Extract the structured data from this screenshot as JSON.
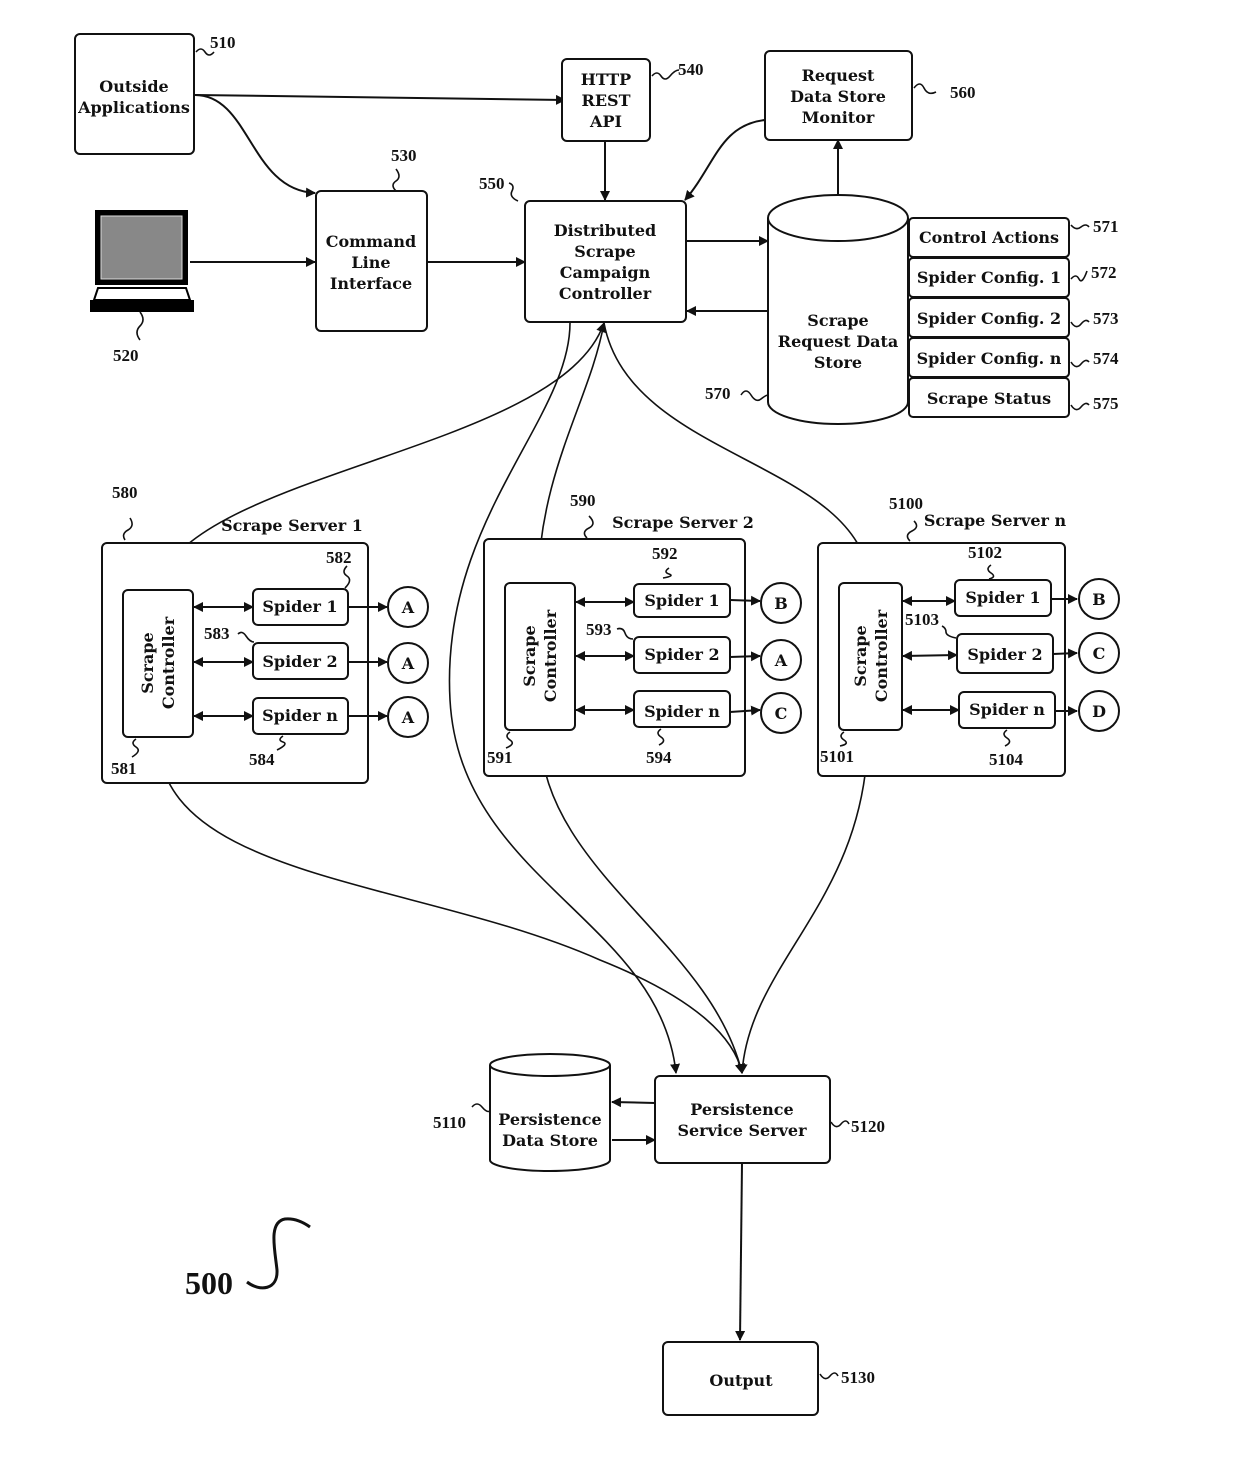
{
  "figure_number": "500",
  "nodes": {
    "outside_apps": {
      "ref": "510",
      "lines": [
        "Outside",
        "Applications"
      ]
    },
    "terminal": {
      "ref": "520",
      "icon": "laptop-icon"
    },
    "cli": {
      "ref": "530",
      "lines": [
        "Command",
        "Line",
        "Interface"
      ]
    },
    "http_api": {
      "ref": "540",
      "lines": [
        "HTTP",
        "REST",
        "API"
      ]
    },
    "controller": {
      "ref": "550",
      "lines": [
        "Distributed",
        "Scrape",
        "Campaign",
        "Controller"
      ]
    },
    "monitor": {
      "ref": "560",
      "lines": [
        "Request",
        "Data Store",
        "Monitor"
      ]
    },
    "request_store": {
      "ref": "570",
      "lines": [
        "Scrape",
        "Request Data",
        "Store"
      ]
    },
    "store_items": [
      {
        "ref": "571",
        "label": "Control Actions"
      },
      {
        "ref": "572",
        "label": "Spider Config. 1"
      },
      {
        "ref": "573",
        "label": "Spider Config. 2"
      },
      {
        "ref": "574",
        "label": "Spider Config. n"
      },
      {
        "ref": "575",
        "label": "Scrape Status"
      }
    ],
    "servers": [
      {
        "ref": "580",
        "title": "Scrape Server 1",
        "controller_ref": "581",
        "controller_lines": [
          "Scrape",
          "Controller"
        ],
        "spiders": [
          {
            "ref": "582",
            "label": "Spider 1",
            "out": "A"
          },
          {
            "ref": "583",
            "label": "Spider 2",
            "out": "A"
          },
          {
            "ref": "584",
            "label": "Spider n",
            "out": "A"
          }
        ]
      },
      {
        "ref": "590",
        "title": "Scrape Server 2",
        "controller_ref": "591",
        "controller_lines": [
          "Scrape",
          "Controller"
        ],
        "spiders": [
          {
            "ref": "592",
            "label": "Spider 1",
            "out": "B"
          },
          {
            "ref": "593",
            "label": "Spider 2",
            "out": "A"
          },
          {
            "ref": "594",
            "label": "Spider n",
            "out": "C"
          }
        ]
      },
      {
        "ref": "5100",
        "title": "Scrape Server n",
        "controller_ref": "5101",
        "controller_lines": [
          "Scrape",
          "Controller"
        ],
        "spiders": [
          {
            "ref": "5102",
            "label": "Spider 1",
            "out": "B"
          },
          {
            "ref": "5103",
            "label": "Spider 2",
            "out": "C"
          },
          {
            "ref": "5104",
            "label": "Spider n",
            "out": "D"
          }
        ]
      }
    ],
    "persistence_store": {
      "ref": "5110",
      "lines": [
        "Persistence",
        "Data Store"
      ]
    },
    "persistence_server": {
      "ref": "5120",
      "lines": [
        "Persistence",
        "Service Server"
      ]
    },
    "output": {
      "ref": "5130",
      "lines": [
        "Output"
      ]
    }
  }
}
